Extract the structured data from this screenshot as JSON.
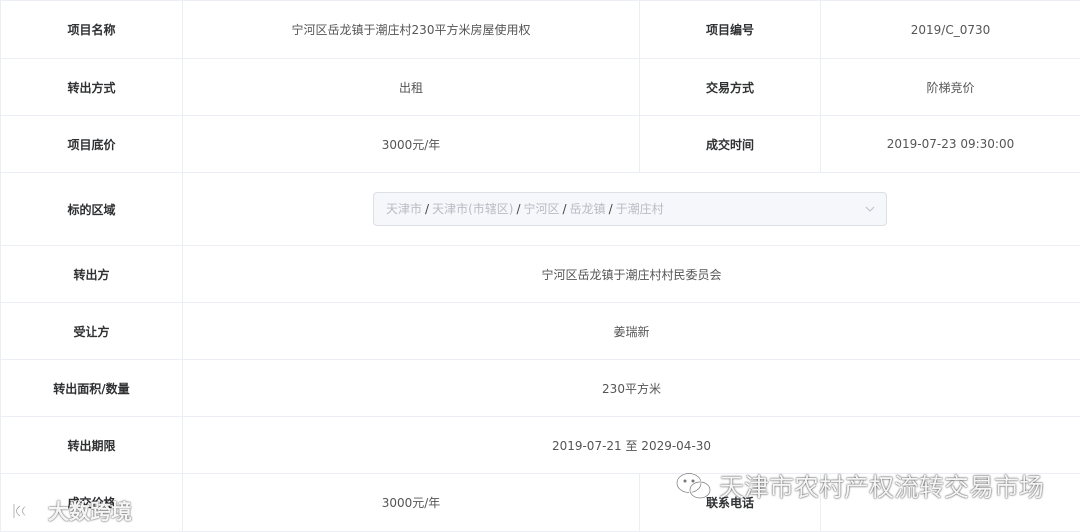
{
  "rows": {
    "project_name": {
      "label": "项目名称",
      "value": "宁河区岳龙镇于潮庄村230平方米房屋使用权"
    },
    "project_no": {
      "label": "项目编号",
      "value": "2019/C_0730"
    },
    "transfer_method": {
      "label": "转出方式",
      "value": "出租"
    },
    "trade_method": {
      "label": "交易方式",
      "value": "阶梯竞价"
    },
    "base_price": {
      "label": "项目底价",
      "value": "3000元/年"
    },
    "deal_time": {
      "label": "成交时间",
      "value": "2019-07-23 09:30:00"
    },
    "region": {
      "label": "标的区域",
      "path": [
        "天津市",
        "天津市(市辖区)",
        "宁河区",
        "岳龙镇",
        "于潮庄村"
      ],
      "separator": "/"
    },
    "transferor": {
      "label": "转出方",
      "value": "宁河区岳龙镇于潮庄村村民委员会"
    },
    "transferee": {
      "label": "受让方",
      "value": "姜瑞新"
    },
    "area": {
      "label": "转出面积/数量",
      "value": "230平方米"
    },
    "period": {
      "label": "转出期限",
      "value": "2019-07-21 至 2029-04-30"
    },
    "deal_price": {
      "label": "成交价格",
      "value": "3000元/年"
    },
    "contact_phone": {
      "label": "联系电话",
      "value": ""
    }
  },
  "watermarks": {
    "left_text": "大数跨境",
    "right_text": "天津市农村产权流转交易市场"
  },
  "icons": {
    "cascader_arrow": "chevron-down-icon",
    "left_logo": "logo-icon",
    "right_logo": "wechat-icon"
  }
}
